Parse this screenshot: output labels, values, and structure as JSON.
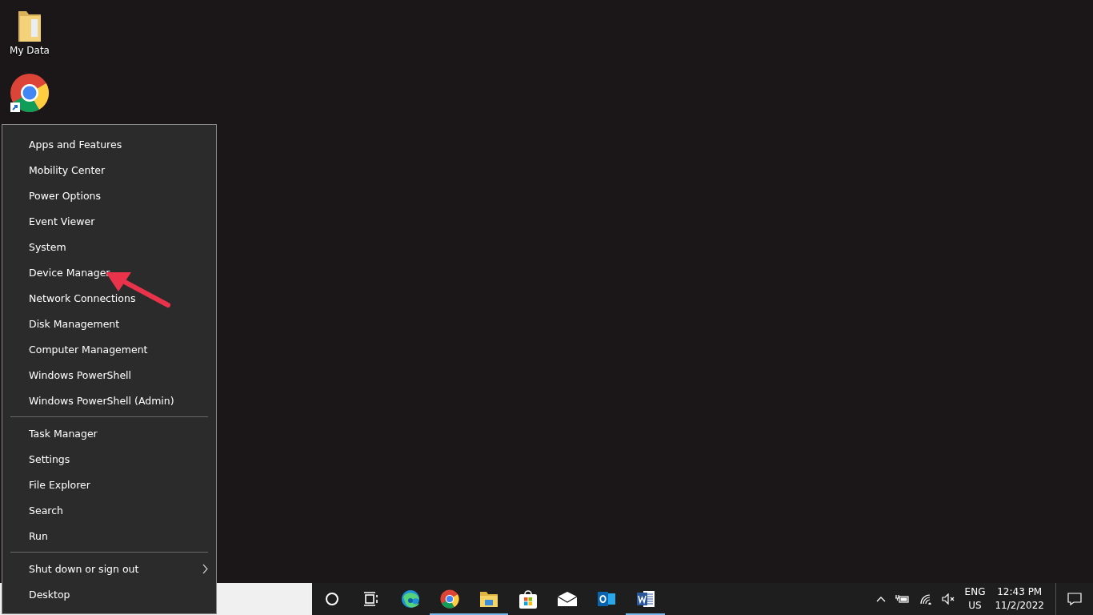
{
  "desktop_icons": [
    {
      "kind": "folder",
      "label": "My Data"
    },
    {
      "kind": "chrome-shortcut"
    }
  ],
  "menu": {
    "groups": [
      {
        "items": [
          "Apps and Features",
          "Mobility Center",
          "Power Options",
          "Event Viewer",
          "System",
          "Device Manager",
          "Network Connections",
          "Disk Management",
          "Computer Management",
          "Windows PowerShell",
          "Windows PowerShell (Admin)"
        ]
      },
      {
        "items": [
          "Task Manager",
          "Settings",
          "File Explorer",
          "Search",
          "Run"
        ]
      },
      {
        "items": [
          "Shut down or sign out",
          "Desktop"
        ],
        "submenu_first": true
      }
    ]
  },
  "taskbar": {
    "apps": [
      {
        "kind": "cortana",
        "running": false
      },
      {
        "kind": "task-view",
        "running": false
      },
      {
        "kind": "edge",
        "running": false
      },
      {
        "kind": "chrome",
        "running": true
      },
      {
        "kind": "explorer",
        "running": true
      },
      {
        "kind": "store",
        "running": false
      },
      {
        "kind": "mail",
        "running": false
      },
      {
        "kind": "outlook",
        "running": false
      },
      {
        "kind": "word",
        "running": true
      }
    ],
    "language": [
      "ENG",
      "US"
    ],
    "time": "12:43 PM",
    "date": "11/2/2022"
  }
}
